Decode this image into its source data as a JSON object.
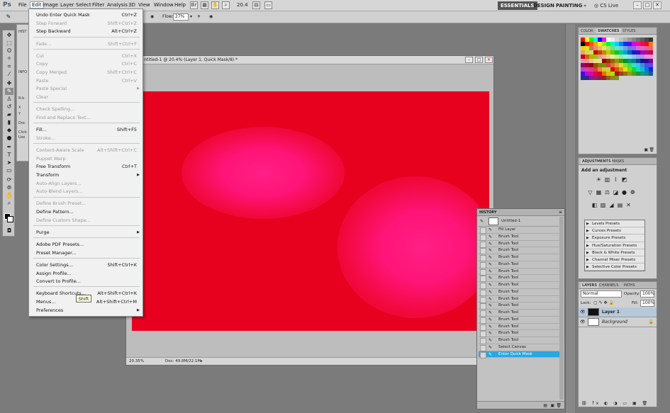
{
  "app": {
    "logo": "Ps"
  },
  "menubar": {
    "items": [
      "File",
      "Edit",
      "Image",
      "Layer",
      "Select",
      "Filter",
      "Analysis",
      "3D",
      "View",
      "Window",
      "Help"
    ],
    "zoom": "20.4",
    "workspaces": [
      "ESSENTIALS",
      "DESIGN",
      "PAINTING"
    ],
    "more": "»",
    "cs_live": "CS Live"
  },
  "options": {
    "flow_label": "Flow:",
    "flow_value": "27%"
  },
  "edit_menu": {
    "groups": [
      [
        {
          "label": "Undo Enter Quick Mask",
          "shortcut": "Ctrl+Z",
          "enabled": true
        },
        {
          "label": "Step Forward",
          "shortcut": "Shift+Ctrl+Z",
          "enabled": false
        },
        {
          "label": "Step Backward",
          "shortcut": "Alt+Ctrl+Z",
          "enabled": true
        }
      ],
      [
        {
          "label": "Fade...",
          "shortcut": "Shift+Ctrl+F",
          "enabled": false
        }
      ],
      [
        {
          "label": "Cut",
          "shortcut": "Ctrl+X",
          "enabled": false
        },
        {
          "label": "Copy",
          "shortcut": "Ctrl+C",
          "enabled": false
        },
        {
          "label": "Copy Merged",
          "shortcut": "Shift+Ctrl+C",
          "enabled": false
        },
        {
          "label": "Paste",
          "shortcut": "Ctrl+V",
          "enabled": false
        },
        {
          "label": "Paste Special",
          "shortcut": "",
          "enabled": false,
          "submenu": true
        },
        {
          "label": "Clear",
          "shortcut": "",
          "enabled": false
        }
      ],
      [
        {
          "label": "Check Spelling...",
          "shortcut": "",
          "enabled": false
        },
        {
          "label": "Find and Replace Text...",
          "shortcut": "",
          "enabled": false
        }
      ],
      [
        {
          "label": "Fill...",
          "shortcut": "Shift+F5",
          "enabled": true
        },
        {
          "label": "Stroke...",
          "shortcut": "",
          "enabled": false
        }
      ],
      [
        {
          "label": "Content-Aware Scale",
          "shortcut": "Alt+Shift+Ctrl+C",
          "enabled": false
        },
        {
          "label": "Puppet Warp",
          "shortcut": "",
          "enabled": false
        },
        {
          "label": "Free Transform",
          "shortcut": "Ctrl+T",
          "enabled": true
        },
        {
          "label": "Transform",
          "shortcut": "",
          "enabled": true,
          "submenu": true
        },
        {
          "label": "Auto-Align Layers...",
          "shortcut": "",
          "enabled": false
        },
        {
          "label": "Auto-Blend Layers...",
          "shortcut": "",
          "enabled": false
        }
      ],
      [
        {
          "label": "Define Brush Preset...",
          "shortcut": "",
          "enabled": false
        },
        {
          "label": "Define Pattern...",
          "shortcut": "",
          "enabled": true
        },
        {
          "label": "Define Custom Shape...",
          "shortcut": "",
          "enabled": false
        }
      ],
      [
        {
          "label": "Purge",
          "shortcut": "",
          "enabled": true,
          "submenu": true
        }
      ],
      [
        {
          "label": "Adobe PDF Presets...",
          "shortcut": "",
          "enabled": true
        },
        {
          "label": "Preset Manager...",
          "shortcut": "",
          "enabled": true
        }
      ],
      [
        {
          "label": "Color Settings...",
          "shortcut": "Shift+Ctrl+K",
          "enabled": true
        },
        {
          "label": "Assign Profile...",
          "shortcut": "",
          "enabled": true
        },
        {
          "label": "Convert to Profile...",
          "shortcut": "",
          "enabled": true
        }
      ],
      [
        {
          "label": "Keyboard Shortcuts...",
          "shortcut": "Alt+Shift+Ctrl+K",
          "enabled": true
        },
        {
          "label": "Menus...",
          "shortcut": "Alt+Shift+Ctrl+M",
          "enabled": true
        },
        {
          "label": "Preferences",
          "shortcut": "",
          "enabled": true,
          "submenu": true
        }
      ]
    ],
    "tooltip": "Shift"
  },
  "document": {
    "title": "ntitled-1 @ 20.4% (Layer 1, Quick Mask/8) *",
    "zoom": "20.35%",
    "doc_info": "Doc: 49.8M/22.1M",
    "canvas_color": "#e8001f",
    "highlight_color": "#ff1478"
  },
  "left_dock": {
    "labels": [
      "HIST",
      "INFO",
      "8-b",
      "X",
      "Y",
      "Doc",
      "Click",
      "Use"
    ]
  },
  "color_panel": {
    "tabs": [
      "COLOR",
      "SWATCHES",
      "STYLES"
    ],
    "active": "SWATCHES"
  },
  "adjustments": {
    "tabs": [
      "ADJUSTMENTS",
      "MASKS"
    ],
    "title": "Add an adjustment",
    "presets": [
      "Levels Presets",
      "Curves Presets",
      "Exposure Presets",
      "Hue/Saturation Presets",
      "Black & White Presets",
      "Channel Mixer Presets",
      "Selective Color Presets"
    ]
  },
  "layers": {
    "tabs": [
      "LAYERS",
      "CHANNELS",
      "PATHS"
    ],
    "blend_mode": "Normal",
    "opacity_label": "Opacity:",
    "opacity": "100%",
    "lock_label": "Lock:",
    "fill_label": "Fill:",
    "fill": "100%",
    "items": [
      {
        "name": "Layer 1",
        "selected": true
      },
      {
        "name": "Background",
        "selected": false
      }
    ]
  },
  "history": {
    "tab": "HISTORY",
    "snapshot": "Untitled-1",
    "items": [
      "Fill Layer",
      "Brush Tool",
      "Brush Tool",
      "Brush Tool",
      "Brush Tool",
      "Brush Tool",
      "Brush Tool",
      "Brush Tool",
      "Brush Tool",
      "Brush Tool",
      "Brush Tool",
      "Brush Tool",
      "Brush Tool",
      "Brush Tool",
      "Brush Tool",
      "Brush Tool",
      "Brush Tool",
      "Select Canvas",
      "Enter Quick Mask"
    ],
    "selected_index": 18,
    "selected_color": "#2aa6e2"
  }
}
